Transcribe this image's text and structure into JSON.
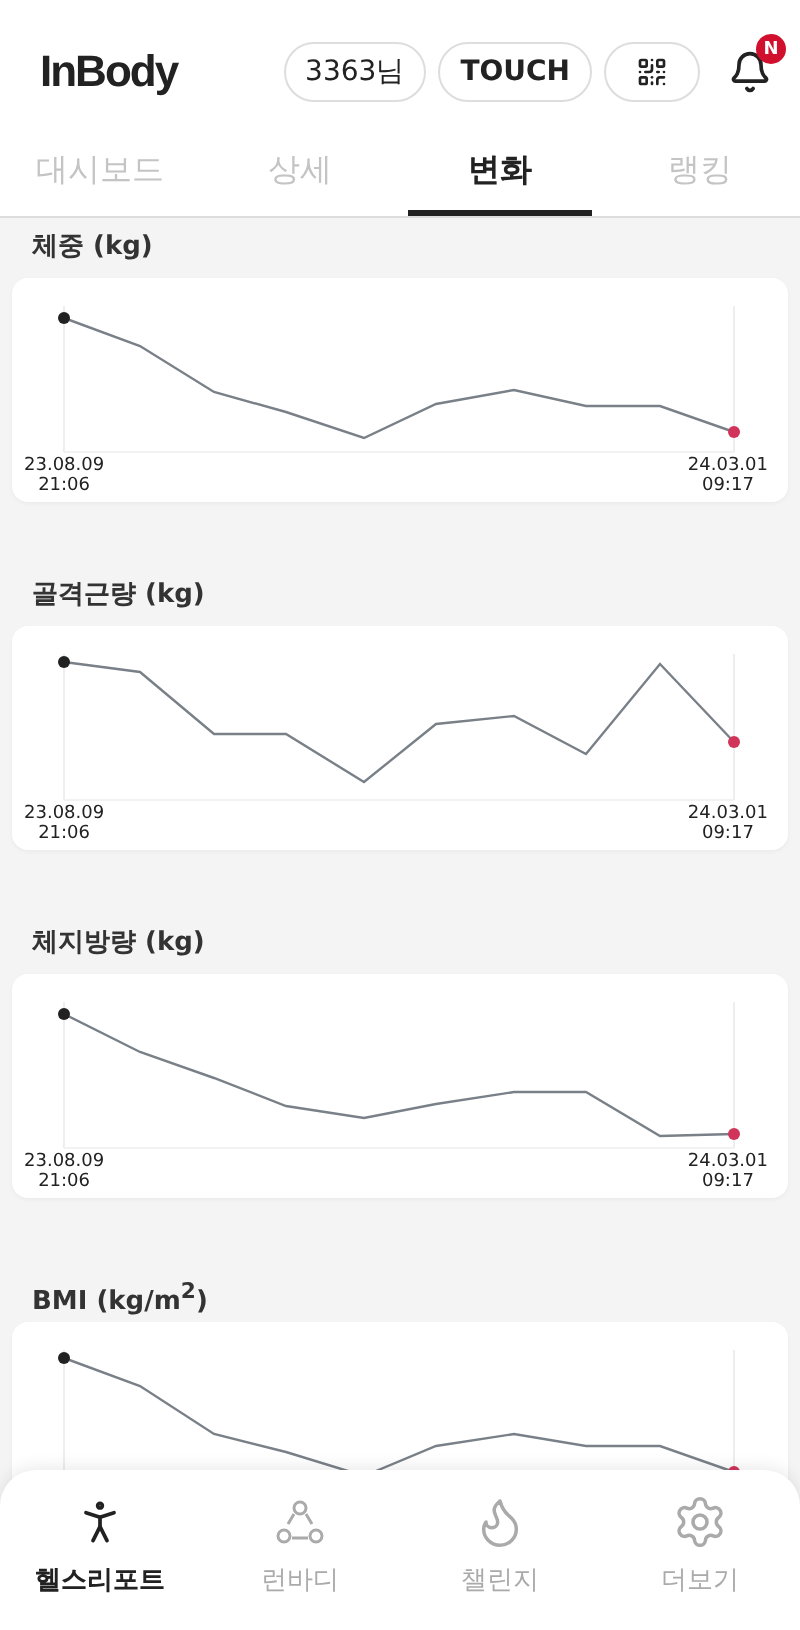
{
  "header": {
    "logo": "InBody",
    "user_chip": "3363님",
    "touch_chip": "TOUCH",
    "notification_badge": "N"
  },
  "tabs": [
    {
      "label": "대시보드",
      "selected": false
    },
    {
      "label": "상세",
      "selected": false
    },
    {
      "label": "변화",
      "selected": true
    },
    {
      "label": "랭킹",
      "selected": false
    }
  ],
  "sections": [
    {
      "title": "체중 (kg)",
      "start_date": "23.08.09",
      "start_time": "21:06",
      "end_date": "24.03.01",
      "end_time": "09:17"
    },
    {
      "title": "골격근량 (kg)",
      "start_date": "23.08.09",
      "start_time": "21:06",
      "end_date": "24.03.01",
      "end_time": "09:17"
    },
    {
      "title": "체지방량 (kg)",
      "start_date": "23.08.09",
      "start_time": "21:06",
      "end_date": "24.03.01",
      "end_time": "09:17"
    },
    {
      "title": "BMI (kg/m$^{2}$)"
    }
  ],
  "bottom_nav": [
    {
      "kind": "health",
      "label": "헬스리포트",
      "selected": true
    },
    {
      "kind": "body",
      "label": "런바디",
      "selected": false
    },
    {
      "kind": "challenge",
      "label": "챌린지",
      "selected": false
    },
    {
      "kind": "more",
      "label": "더보기",
      "selected": false
    }
  ]
}
